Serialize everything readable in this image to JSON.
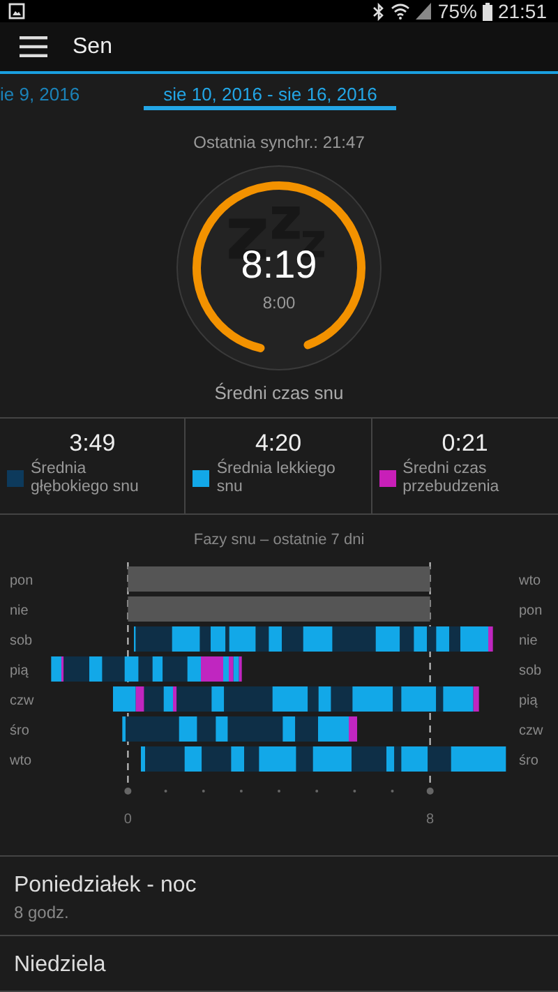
{
  "status_bar": {
    "battery": "75%",
    "time": "21:51"
  },
  "app_bar": {
    "title": "Sen"
  },
  "tabs": [
    {
      "label": "ie 9, 2016",
      "selected": false
    },
    {
      "label": "sie 10, 2016 - sie 16, 2016",
      "selected": true
    }
  ],
  "summary": {
    "last_sync": "Ostatnia synchr.: 21:47",
    "value": "8:19",
    "goal": "8:00",
    "caption": "Średni czas snu"
  },
  "stats": [
    {
      "value": "3:49",
      "label": "Średnia głębokiego snu",
      "color": "#0d3a5c"
    },
    {
      "value": "4:20",
      "label": "Średnia lekkiego snu",
      "color": "#12a8e8"
    },
    {
      "value": "0:21",
      "label": "Średni czas przebudzenia",
      "color": "#c81fb8"
    }
  ],
  "sleep_chart": {
    "title": "Fazy snu – ostatnie 7 dni",
    "rows": [
      {
        "left": "pon",
        "right": "wto"
      },
      {
        "left": "nie",
        "right": "pon"
      },
      {
        "left": "sob",
        "right": "nie"
      },
      {
        "left": "pią",
        "right": "sob"
      },
      {
        "left": "czw",
        "right": "pią"
      },
      {
        "left": "śro",
        "right": "czw"
      },
      {
        "left": "wto",
        "right": "śro"
      }
    ],
    "axis_labels": [
      "0",
      "8"
    ]
  },
  "nights": [
    {
      "title": "Poniedziałek - noc",
      "duration": "8 godz."
    },
    {
      "title": "Niedziela"
    }
  ]
}
